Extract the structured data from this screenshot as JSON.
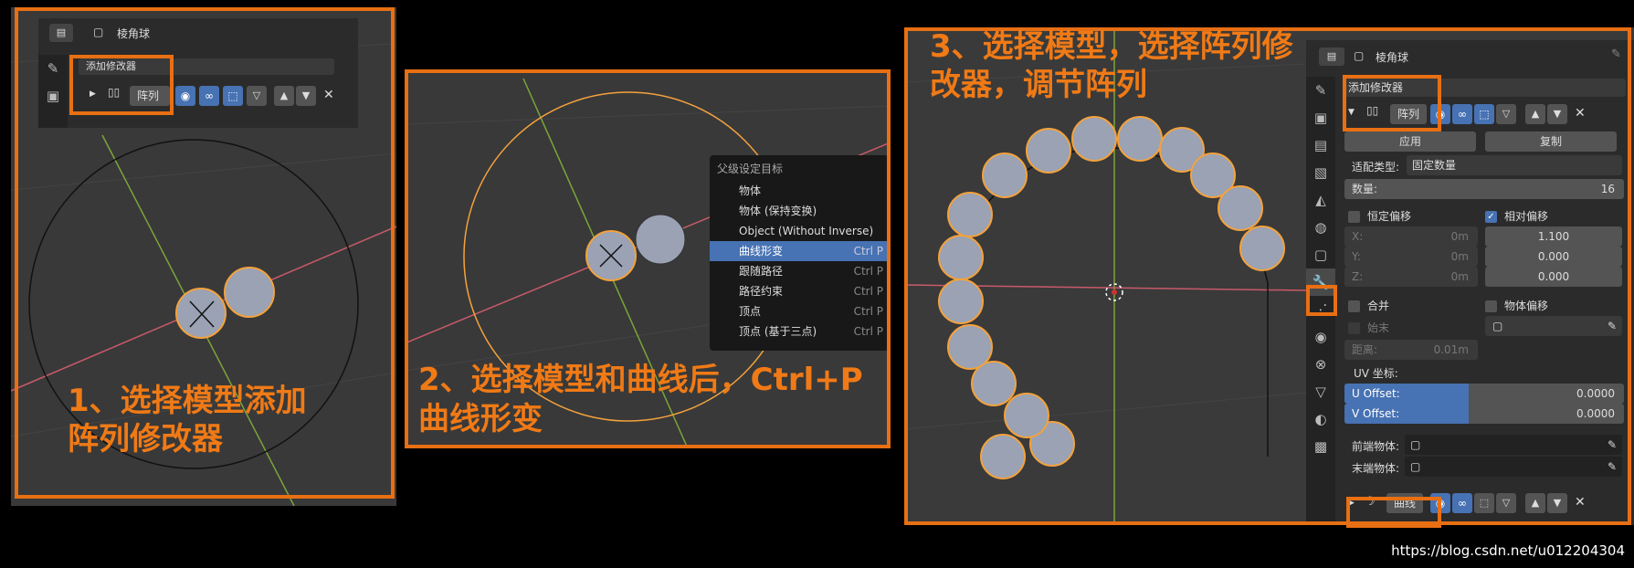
{
  "panel1": {
    "object_name": "棱角球",
    "add_modifier": "添加修改器",
    "modifier_name": "阵列",
    "caption_line1": "1、选择模型添加",
    "caption_line2": "阵列修改器"
  },
  "panel2": {
    "caption_line1": "2、选择模型和曲线后，Ctrl+P",
    "caption_line2": "曲线形变",
    "menu": {
      "title": "父级设定目标",
      "items": [
        {
          "label": "物体",
          "shortcut": ""
        },
        {
          "label": "物体 (保持变换)",
          "shortcut": ""
        },
        {
          "label": "Object (Without Inverse)",
          "shortcut": ""
        },
        {
          "label": "曲线形变",
          "shortcut": "Ctrl P"
        },
        {
          "label": "跟随路径",
          "shortcut": "Ctrl P"
        },
        {
          "label": "路径约束",
          "shortcut": "Ctrl P"
        },
        {
          "label": "顶点",
          "shortcut": "Ctrl P"
        },
        {
          "label": "顶点 (基于三点)",
          "shortcut": "Ctrl P"
        }
      ]
    }
  },
  "panel3": {
    "caption_line1": "3、选择模型，选择阵列修",
    "caption_line2": "改器，调节阵列",
    "object_name": "棱角球",
    "add_modifier": "添加修改器",
    "modifier_name": "阵列",
    "apply": "应用",
    "copy": "复制",
    "fit_type_label": "适配类型:",
    "fit_type_value": "固定数量",
    "count_label": "数量:",
    "count_value": "16",
    "constant_offset": "恒定偏移",
    "relative_offset": "相对偏移",
    "x_label": "X:",
    "x_value": "0m",
    "y_label": "Y:",
    "y_value": "0m",
    "z_label": "Z:",
    "z_value": "0m",
    "rel_x": "1.100",
    "rel_y": "0.000",
    "rel_z": "0.000",
    "merge": "合并",
    "object_offset": "物体偏移",
    "first_last": "始末",
    "distance_label": "距离:",
    "distance_value": "0.01m",
    "uv_label": "UV 坐标:",
    "u_offset_label": "U Offset:",
    "u_offset_value": "0.0000",
    "v_offset_label": "V Offset:",
    "v_offset_value": "0.0000",
    "start_cap": "前端物体:",
    "end_cap": "末端物体:",
    "curve_modifier": "曲线"
  },
  "watermark": "https://blog.csdn.net/u012204304",
  "colors": {
    "accent_orange": "#e86f13",
    "blender_blue": "#4772b3",
    "selected_orange": "#f4a23c"
  }
}
